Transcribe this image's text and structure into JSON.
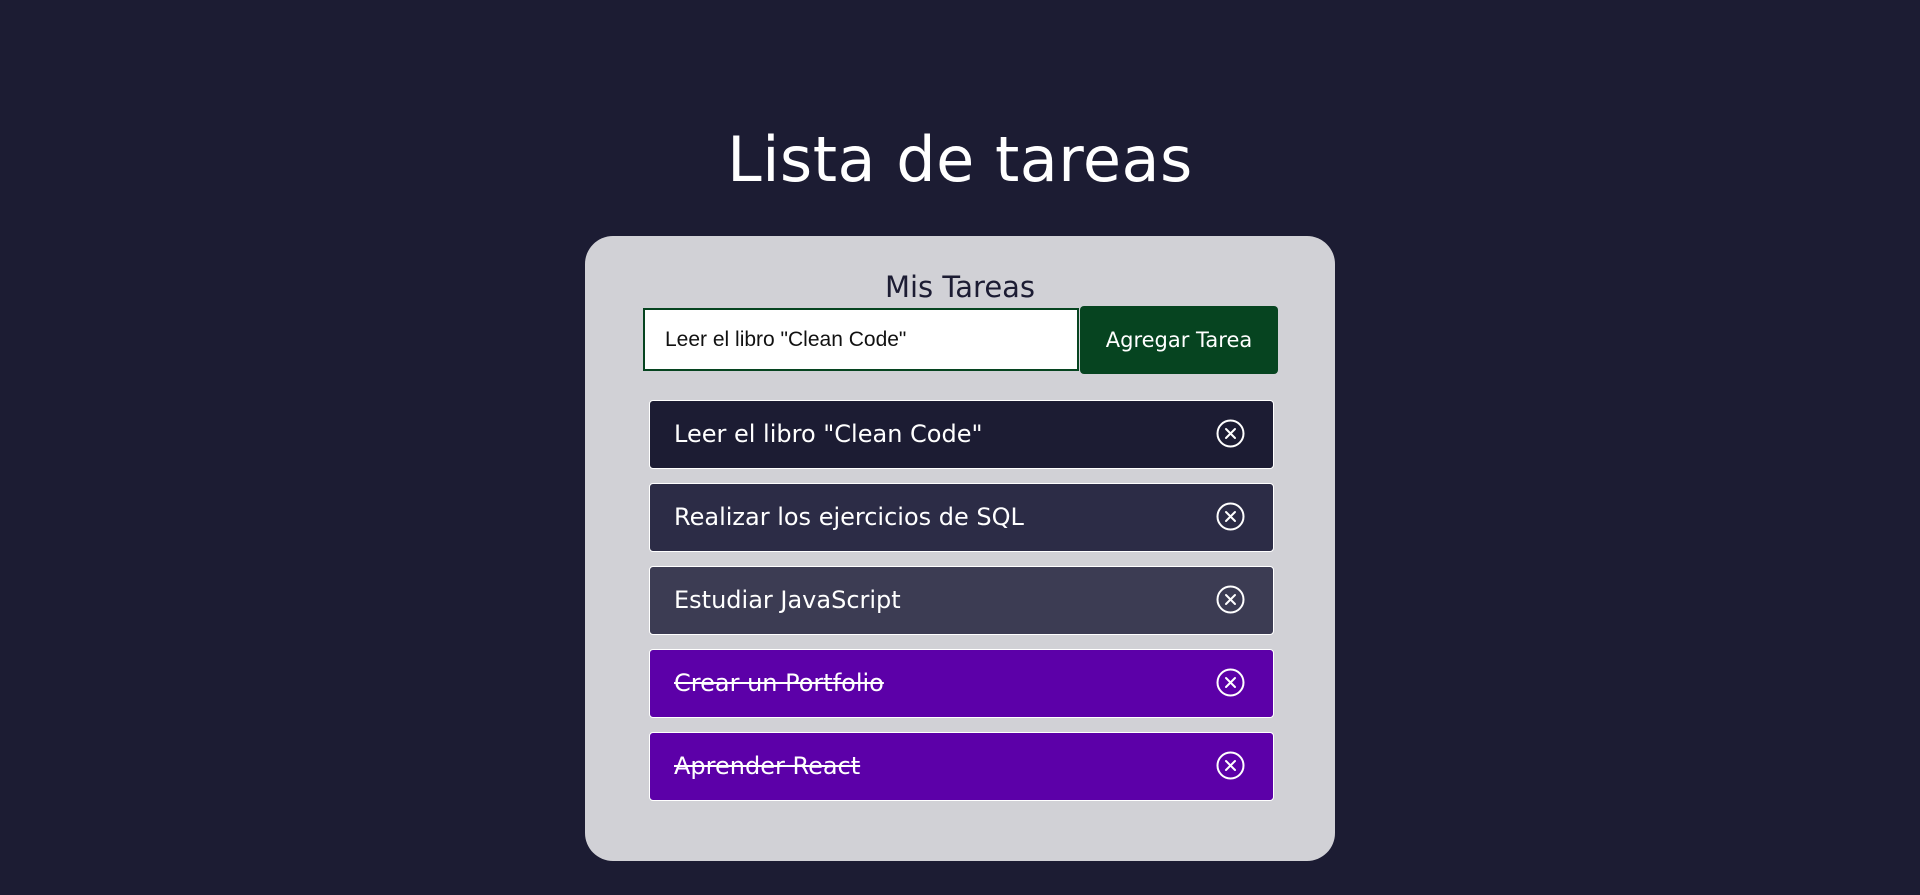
{
  "header": {
    "title": "Lista de tareas"
  },
  "card": {
    "title": "Mis Tareas",
    "input_value": "Leer el libro \"Clean Code\"",
    "add_button_label": "Agregar Tarea"
  },
  "tasks": [
    {
      "text": "Leer el libro \"Clean Code\"",
      "completed": false,
      "icon": "close-circle-icon"
    },
    {
      "text": "Realizar los ejercicios de SQL",
      "completed": false,
      "icon": "close-circle-icon"
    },
    {
      "text": "Estudiar JavaScript",
      "completed": false,
      "icon": "close-circle-icon"
    },
    {
      "text": "Crear un Portfolio",
      "completed": true,
      "icon": "close-circle-icon"
    },
    {
      "text": "Aprender React",
      "completed": true,
      "icon": "close-circle-icon"
    }
  ],
  "colors": {
    "background": "#1c1c33",
    "card": "#d1d1d6",
    "accent_green": "#064420",
    "completed_purple": "#5c00a8"
  }
}
